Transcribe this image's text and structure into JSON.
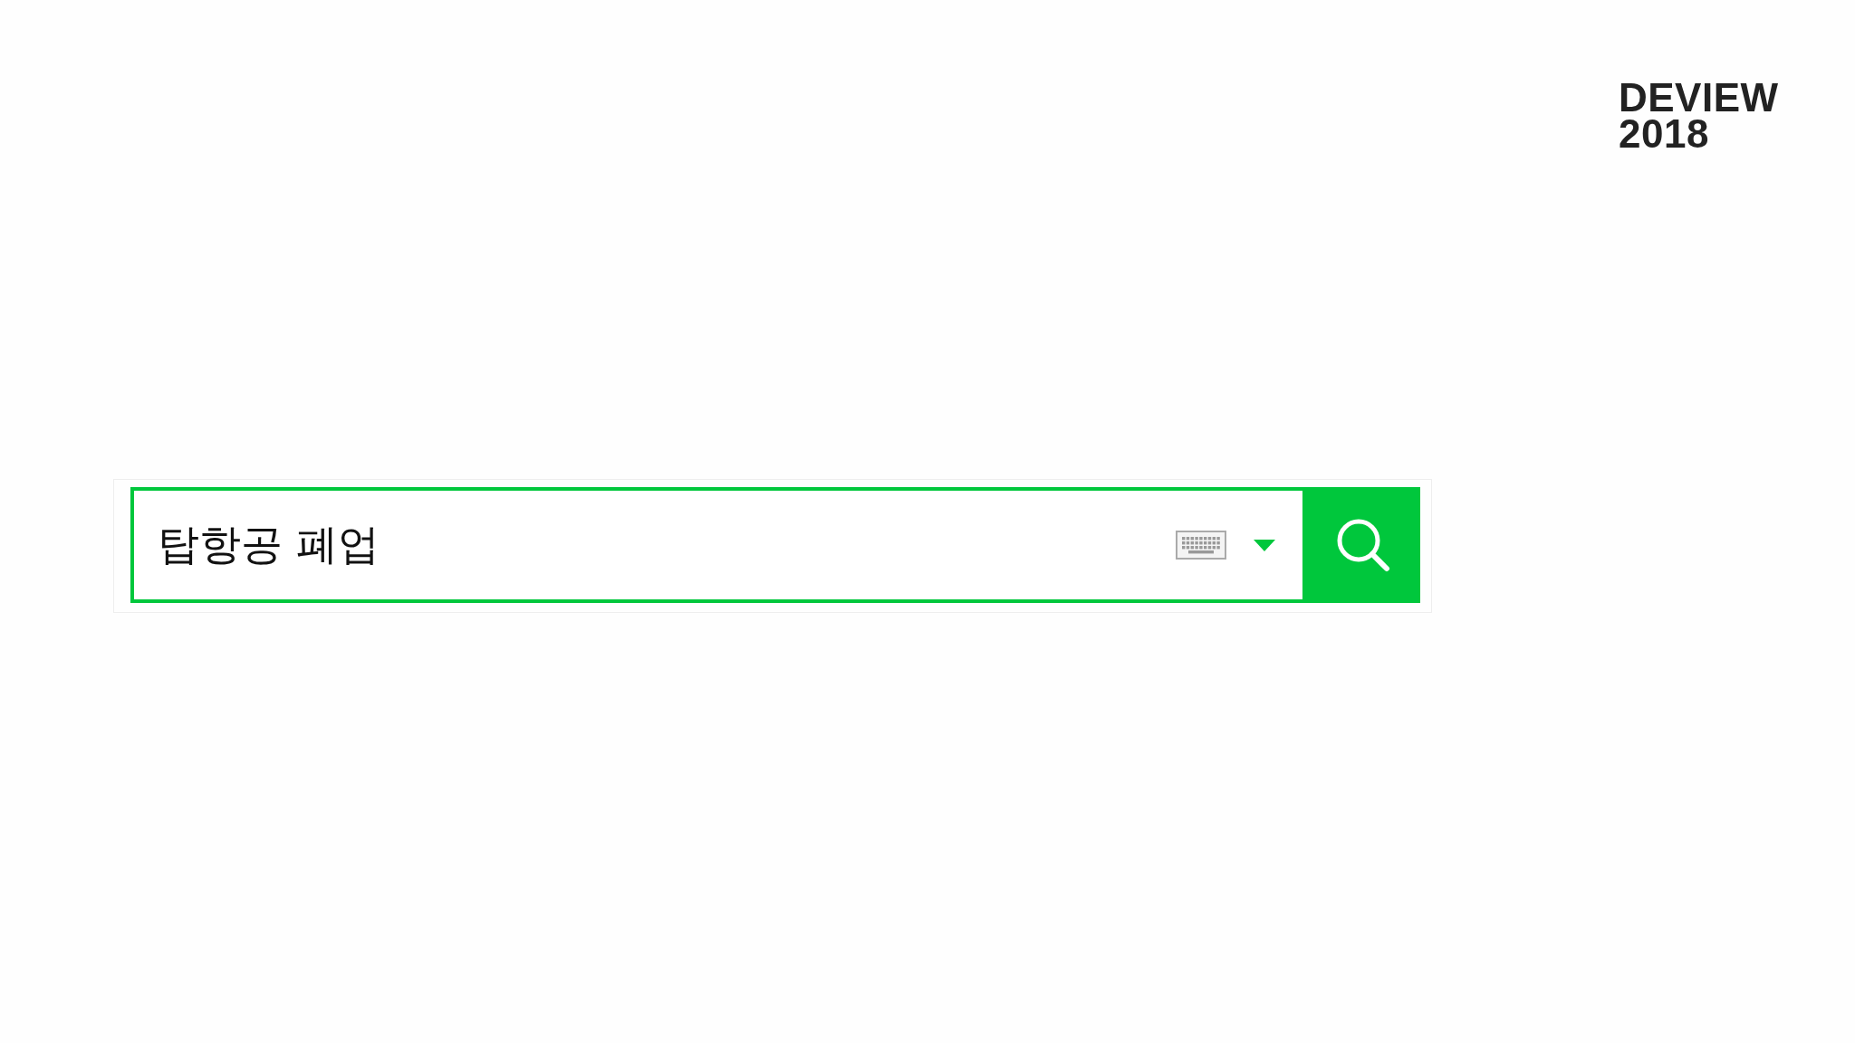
{
  "logo": {
    "lines": [
      "DEVIEW",
      "2018"
    ]
  },
  "search": {
    "value": "탑항공 폐업"
  }
}
